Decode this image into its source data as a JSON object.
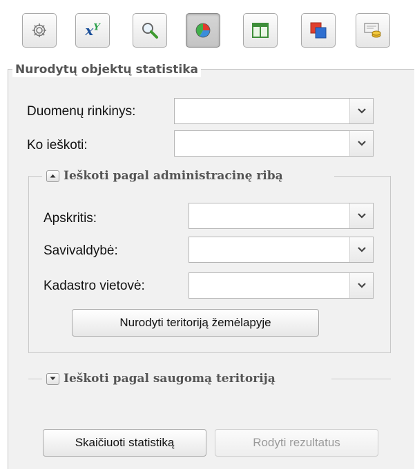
{
  "toolbar": {
    "tools": [
      {
        "icon": "gear-icon",
        "active": false
      },
      {
        "icon": "xy-icon",
        "active": false
      },
      {
        "icon": "magnifier-icon",
        "active": false
      },
      {
        "icon": "pie-chart-icon",
        "active": true
      },
      {
        "icon": "table-layout-icon",
        "active": false
      },
      {
        "icon": "overlapping-windows-icon",
        "active": false
      },
      {
        "icon": "coins-icon",
        "active": false
      }
    ],
    "xy_sub": "x",
    "xy_sup": "Y"
  },
  "panel": {
    "legend": "Nurodytų objektų statistika",
    "dataset_label": "Duomenų rinkinys:",
    "dataset_value": "",
    "search_label": "Ko ieškoti:",
    "search_value": ""
  },
  "admin": {
    "legend": "Ieškoti pagal administracinę ribą",
    "expanded": true,
    "county_label": "Apskritis:",
    "county_value": "",
    "municipality_label": "Savivaldybė:",
    "municipality_value": "",
    "cadastre_label": "Kadastro vietovė:",
    "cadastre_value": "",
    "map_button": "Nurodyti teritoriją žemėlapyje"
  },
  "protected": {
    "legend": "Ieškoti pagal saugomą teritoriją",
    "expanded": false
  },
  "actions": {
    "calculate": "Skaičiuoti statistiką",
    "show_results": "Rodyti rezultatus"
  }
}
